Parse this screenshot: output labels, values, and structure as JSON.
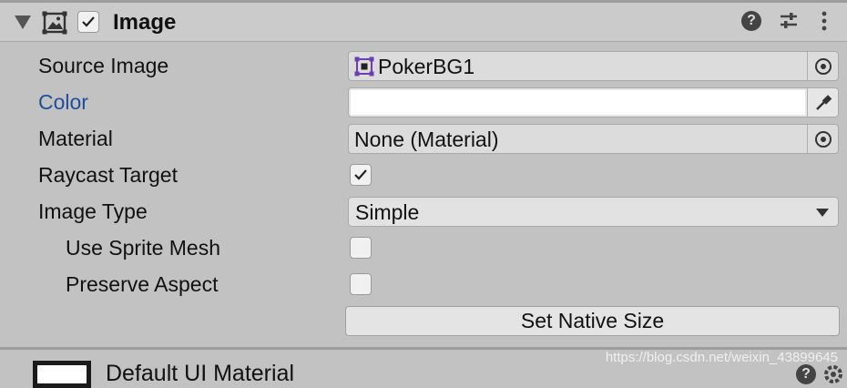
{
  "component": {
    "title": "Image",
    "enabled": true,
    "icons": [
      "help-icon",
      "preset-icon",
      "more-icon"
    ]
  },
  "fields": {
    "source_image": {
      "label": "Source Image",
      "value": "PokerBG1",
      "icon": "sprite-icon"
    },
    "color": {
      "label": "Color",
      "value": "#FFFFFF"
    },
    "material": {
      "label": "Material",
      "value": "None (Material)"
    },
    "raycast_target": {
      "label": "Raycast Target",
      "checked": true
    },
    "image_type": {
      "label": "Image Type",
      "value": "Simple"
    },
    "use_sprite_mesh": {
      "label": "Use Sprite Mesh",
      "checked": false
    },
    "preserve_aspect": {
      "label": "Preserve Aspect",
      "checked": false
    }
  },
  "buttons": {
    "set_native_size": "Set Native Size"
  },
  "next_component": {
    "title": "Default UI Material"
  },
  "watermark": "https://blog.csdn.net/weixin_43899645",
  "colors": {
    "label_highlight": "#1d4f9a",
    "panel": "#c2c2c2",
    "sprite_icon": "#6a3fb0"
  }
}
